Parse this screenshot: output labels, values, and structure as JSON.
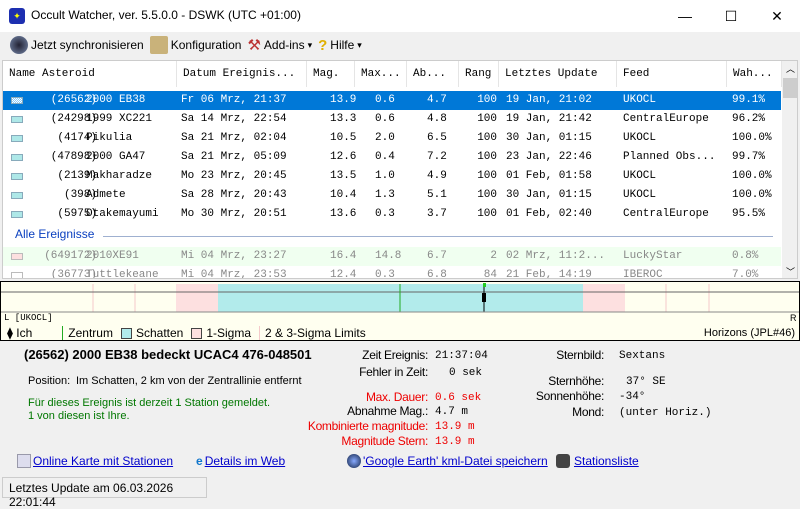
{
  "window": {
    "title": "Occult Watcher, ver. 5.5.0.0 - DSWK (UTC +01:00)",
    "minimize": "—",
    "maximize": "☐",
    "close": "✕"
  },
  "toolbar": {
    "sync": "Jetzt synchronisieren",
    "config": "Konfiguration",
    "addins": "Add-ins",
    "help": "Hilfe",
    "dropdown": "▾"
  },
  "list": {
    "columns": [
      "Name Asteroid",
      "Datum Ereignis...",
      "Mag.",
      "Max...",
      "Ab...",
      "Rang",
      "Letztes Update",
      "Feed",
      "Wah..."
    ],
    "rows": [
      {
        "id": "(26562)",
        "name": "2000 EB38",
        "date": "Fr 06 Mrz, 21:37",
        "mag": "13.9",
        "max": "0.6",
        "ab": "4.7",
        "rang": "100",
        "update": "19 Jan, 21:02",
        "feed": "UKOCL",
        "wah": "99.1%"
      },
      {
        "id": "(24298)",
        "name": "1999 XC221",
        "date": "Sa 14 Mrz, 22:54",
        "mag": "13.3",
        "max": "0.6",
        "ab": "4.8",
        "rang": "100",
        "update": "19 Jan, 21:42",
        "feed": "CentralEurope",
        "wah": "96.2%"
      },
      {
        "id": "(4174)",
        "name": "Pikulia",
        "date": "Sa 21 Mrz, 02:04",
        "mag": "10.5",
        "max": "2.0",
        "ab": "6.5",
        "rang": "100",
        "update": "30 Jan, 01:15",
        "feed": "UKOCL",
        "wah": "100.0%"
      },
      {
        "id": "(47898)",
        "name": "2000 GA47",
        "date": "Sa 21 Mrz, 05:09",
        "mag": "12.6",
        "max": "0.4",
        "ab": "7.2",
        "rang": "100",
        "update": "23 Jan, 22:46",
        "feed": "Planned Obs...",
        "wah": "99.7%"
      },
      {
        "id": "(2139)",
        "name": "Makharadze",
        "date": "Mo 23 Mrz, 20:45",
        "mag": "13.5",
        "max": "1.0",
        "ab": "4.9",
        "rang": "100",
        "update": "01 Feb, 01:58",
        "feed": "UKOCL",
        "wah": "100.0%"
      },
      {
        "id": "(398)",
        "name": "Admete",
        "date": "Sa 28 Mrz, 20:43",
        "mag": "10.4",
        "max": "1.3",
        "ab": "5.1",
        "rang": "100",
        "update": "30 Jan, 01:15",
        "feed": "UKOCL",
        "wah": "100.0%"
      },
      {
        "id": "(5975)",
        "name": "Otakemayumi",
        "date": "Mo 30 Mrz, 20:51",
        "mag": "13.6",
        "max": "0.3",
        "ab": "3.7",
        "rang": "100",
        "update": "01 Feb, 02:40",
        "feed": "CentralEurope",
        "wah": "95.5%"
      }
    ],
    "group_label": "Alle Ereignisse",
    "all_rows": [
      {
        "id": "(649172)",
        "name": "2010XE91",
        "date": "Mi 04 Mrz, 23:27",
        "mag": "16.4",
        "max": "14.8",
        "ab": "6.7",
        "rang": "2",
        "update": "02 Mrz, 11:2...",
        "feed": "LuckyStar",
        "wah": "0.8%"
      },
      {
        "id": "(36773)",
        "name": "Tuttlekeane",
        "date": "Mi 04 Mrz, 23:53",
        "mag": "12.4",
        "max": "0.3",
        "ab": "6.8",
        "rang": "84",
        "update": "21 Feb, 14:19",
        "feed": "IBEROC",
        "wah": "7.0%"
      }
    ]
  },
  "timeline": {
    "left": "L [UKOCL]",
    "right": "R",
    "legend": [
      "Ich",
      "Zentrum",
      "Schatten",
      "1-Sigma",
      "2 & 3-Sigma Limits"
    ],
    "source": "Horizons (JPL#46)"
  },
  "details": {
    "title": "(26562) 2000 EB38 bedeckt UCAC4 476-048501",
    "position_label": "Position:",
    "position": "Im Schatten, 2 km von der Zentrallinie entfernt",
    "stations1": "Für dieses Ereignis ist derzeit 1 Station gemeldet.",
    "stations2": "1 von diesen ist Ihre.",
    "time_label": "Zeit Ereignis:",
    "time": "21:37:04",
    "err_label": "Fehler in Zeit:",
    "err": "0 sek",
    "dur_label": "Max. Dauer:",
    "dur": "0.6 sek",
    "drop_label": "Abnahme Mag.:",
    "drop": "4.7 m",
    "comb_label": "Kombinierte magnitude:",
    "comb": "13.9 m",
    "star_label": "Magnitude Stern:",
    "star": "13.9 m",
    "const_label": "Sternbild:",
    "const": "Sextans",
    "alt_label": "Sternhöhe:",
    "alt": "37° SE",
    "sun_label": "Sonnenhöhe:",
    "sun": "-34°",
    "moon_label": "Mond:",
    "moon": "(unter Horiz.)"
  },
  "links": [
    "Online Karte mit Stationen",
    "Details im Web",
    "'Google Earth' kml-Datei speichern",
    "Stationsliste"
  ],
  "status": "Letztes Update am 06.03.2026 22:01:44"
}
